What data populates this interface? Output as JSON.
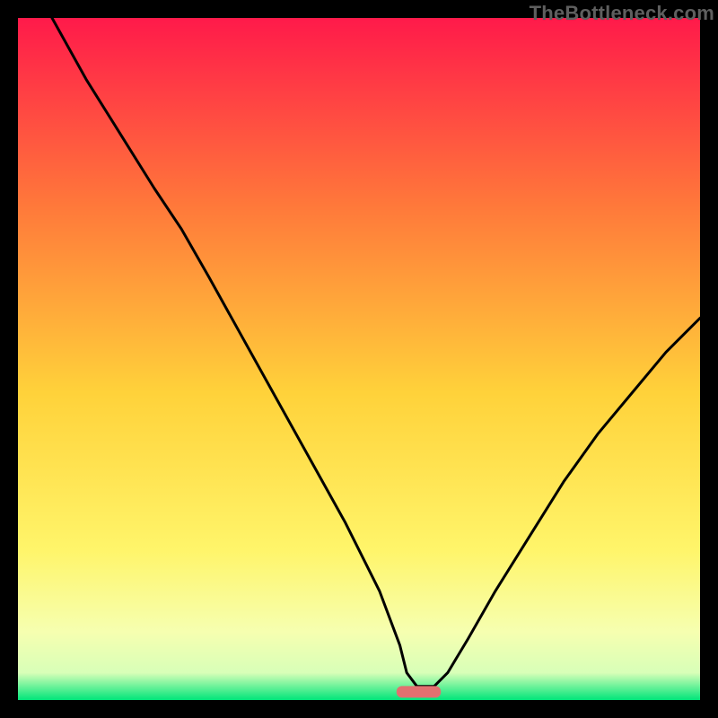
{
  "watermark": "TheBottleneck.com",
  "colors": {
    "gradient_top": "#ff1a4a",
    "gradient_upper_mid": "#ff7a3a",
    "gradient_mid": "#ffd23a",
    "gradient_lower_mid": "#fff56a",
    "gradient_pale": "#f6ffb0",
    "gradient_bottom": "#00e57a",
    "curve": "#000000",
    "marker": "#e27070",
    "frame": "#000000"
  },
  "chart_data": {
    "type": "line",
    "title": "",
    "xlabel": "",
    "ylabel": "",
    "xlim": [
      0,
      100
    ],
    "ylim": [
      0,
      100
    ],
    "series": [
      {
        "name": "bottleneck-curve",
        "x": [
          5,
          10,
          15,
          20,
          24,
          28,
          33,
          38,
          43,
          48,
          53,
          56,
          57,
          58.5,
          61,
          63,
          66,
          70,
          75,
          80,
          85,
          90,
          95,
          100
        ],
        "y": [
          100,
          91,
          83,
          75,
          69,
          62,
          53,
          44,
          35,
          26,
          16,
          8,
          4,
          2,
          2,
          4,
          9,
          16,
          24,
          32,
          39,
          45,
          51,
          56
        ]
      }
    ],
    "marker": {
      "name": "optimal-range",
      "x_start": 55.5,
      "x_end": 62,
      "y": 1.2
    }
  }
}
